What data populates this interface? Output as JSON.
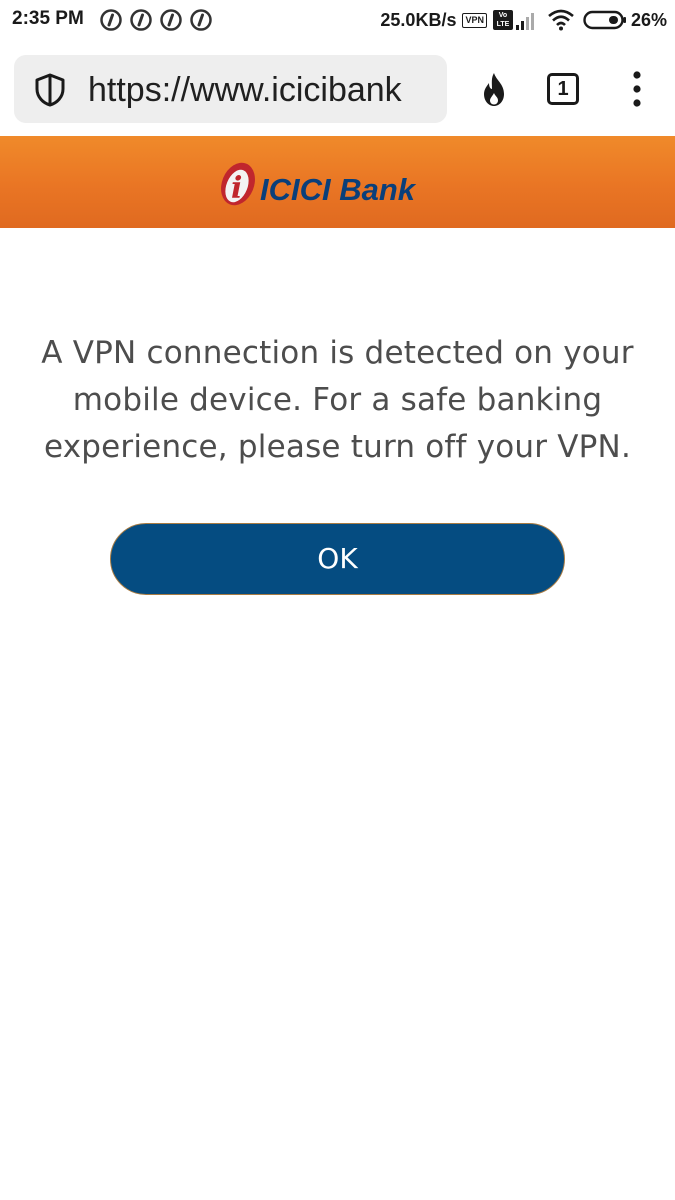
{
  "status_bar": {
    "time": "2:35 PM",
    "notification_icons": [
      "app-notification-icon",
      "app-notification-icon",
      "app-notification-icon",
      "app-notification-icon"
    ],
    "net_speed": "25.0KB/s",
    "vpn_badge": "VPN",
    "volte_badge_top": "Vo",
    "volte_badge_bottom": "LTE",
    "battery_percent": "26%"
  },
  "browser": {
    "url": "https://www.icicibank",
    "tab_count": "1",
    "icons": [
      "shield-icon",
      "fire-icon",
      "tabs-icon",
      "more-menu-icon"
    ]
  },
  "header": {
    "logo_text": "ICICI Bank",
    "logo_letter": "i",
    "colors": {
      "header_orange": "#e97524",
      "logo_blue": "#0a3f7a",
      "logo_red": "#c0262d"
    }
  },
  "dialog": {
    "message": "A VPN connection is detected on your mobile device. For a safe banking experience, please turn off your VPN.",
    "ok_label": "OK",
    "colors": {
      "button_bg": "#054c81",
      "message_text": "#4d4d4d"
    }
  }
}
